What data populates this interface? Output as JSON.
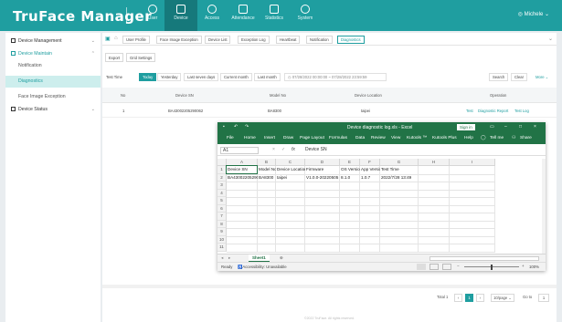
{
  "app": {
    "title": "TruFace Manager",
    "user": "Michele"
  },
  "nav": [
    {
      "id": "user",
      "label": "User"
    },
    {
      "id": "device",
      "label": "Device"
    },
    {
      "id": "access",
      "label": "Access"
    },
    {
      "id": "attendance",
      "label": "Attendance"
    },
    {
      "id": "statistics",
      "label": "Statistics"
    },
    {
      "id": "system",
      "label": "System"
    }
  ],
  "sidebar": {
    "device_management": "Device Management",
    "device_maintain": "Device Maintain",
    "notification": "Notification",
    "diagnostics": "Diagnostics",
    "face_image_exception": "Face Image Exception",
    "device_status": "Device Status"
  },
  "tabs": [
    "User Profile",
    "Face Image Exception",
    "Device List",
    "Exception Log",
    "Heartbeat",
    "Notification",
    "Diagnostics"
  ],
  "toolbar": {
    "export": "Export",
    "grid_settings": "Grid Settings"
  },
  "filters": {
    "test_time_label": "Test Time",
    "options": [
      "Today",
      "Yesterday",
      "Last seven days",
      "Current month",
      "Last month"
    ],
    "date_from": "07/28/2022 00:00:00",
    "date_sep": "~",
    "date_to": "07/28/2022 23:59:59",
    "search": "Search",
    "clear": "Clear",
    "more": "More"
  },
  "table": {
    "headers": {
      "no": "No",
      "device_sn": "Device SN",
      "model_no": "Model No",
      "device_location": "Device Location",
      "operation": "Operation"
    },
    "row": {
      "no": "1",
      "device_sn": "BA43002205290062",
      "model_no": "BA8300",
      "device_location": "taipei",
      "ops": [
        "Test",
        "Diagnostic Report",
        "Test Log"
      ]
    }
  },
  "pagination": {
    "total": "Total 1",
    "page": "1",
    "per_page": "10/page",
    "goto_label": "Go to",
    "goto_value": "1"
  },
  "footer": "©2022 TruFace. All rights reserved.",
  "excel": {
    "title": "Device diagnostic log.xls  -  Excel",
    "signin": "Sign in",
    "ribbon": [
      "File",
      "Home",
      "Insert",
      "Draw",
      "Page Layout",
      "Formulas",
      "Data",
      "Review",
      "View",
      "Kutools ™",
      "Kutools Plus",
      "Help",
      "Tell me",
      "Share"
    ],
    "namebox": "A1",
    "fx": "fx",
    "formula": "Device SN",
    "columns": [
      "A",
      "B",
      "C",
      "D",
      "E",
      "F",
      "G",
      "H",
      "I"
    ],
    "rows": [
      "1",
      "2",
      "3",
      "4",
      "5",
      "6",
      "7",
      "8",
      "9",
      "10",
      "11"
    ],
    "header_row": [
      "Device SN",
      "Model No",
      "Device Location",
      "Firmware",
      "OS Version",
      "App Version",
      "Test Time"
    ],
    "data_row": [
      "BA43002205290062",
      "BA8300",
      "taipei",
      "V1.0.0-20220505",
      "8.1.0",
      "1.0.7",
      "2022/7/28 13:49"
    ],
    "sheet": "Sheet1",
    "status_ready": "Ready",
    "accessibility": "Accessibility: Unavailable",
    "zoom": "100%"
  }
}
